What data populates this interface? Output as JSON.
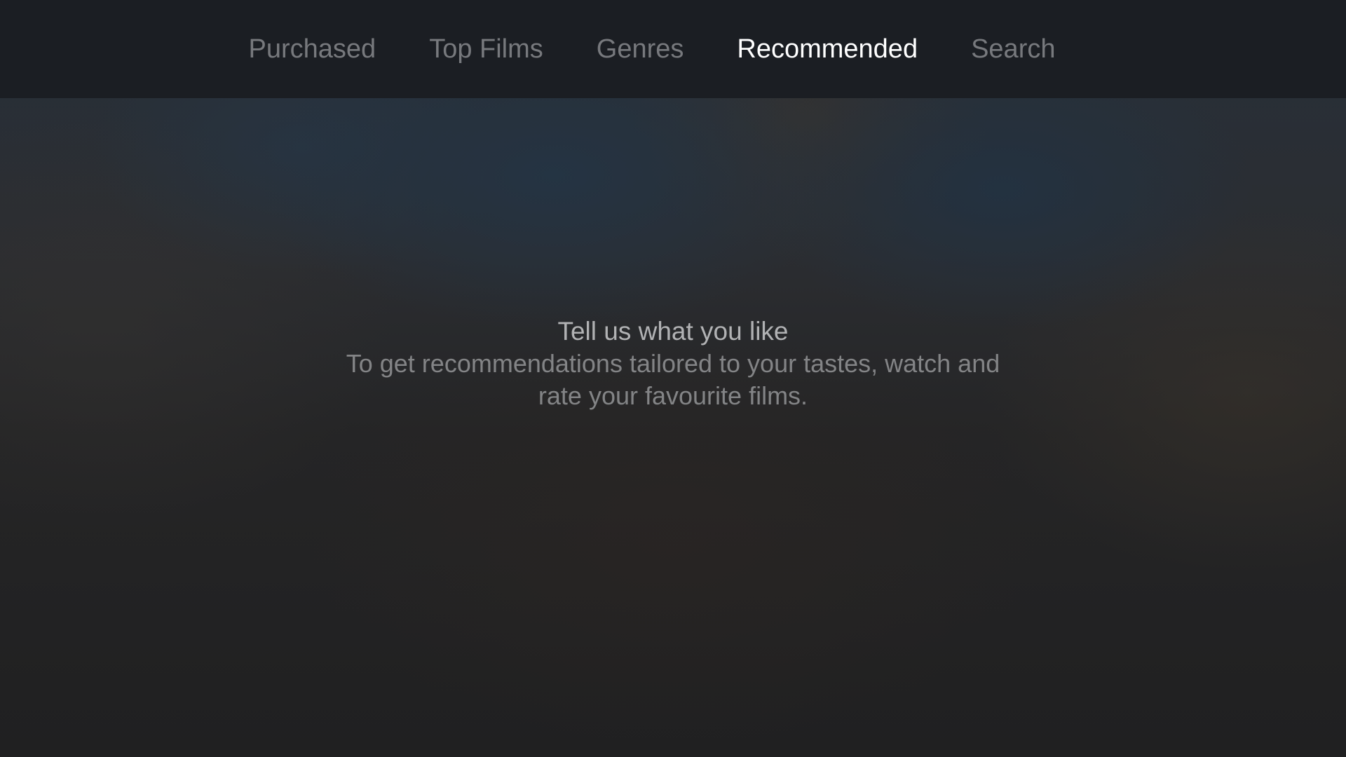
{
  "nav": {
    "tabs": [
      {
        "label": "Purchased",
        "active": false
      },
      {
        "label": "Top Films",
        "active": false
      },
      {
        "label": "Genres",
        "active": false
      },
      {
        "label": "Recommended",
        "active": true
      },
      {
        "label": "Search",
        "active": false
      }
    ]
  },
  "empty_state": {
    "title": "Tell us what you like",
    "body": "To get recommendations tailored to your tastes, watch and rate your favourite films."
  },
  "colors": {
    "nav_background": "#1b1e23",
    "tab_inactive": "#77797d",
    "tab_active": "#ffffff"
  }
}
